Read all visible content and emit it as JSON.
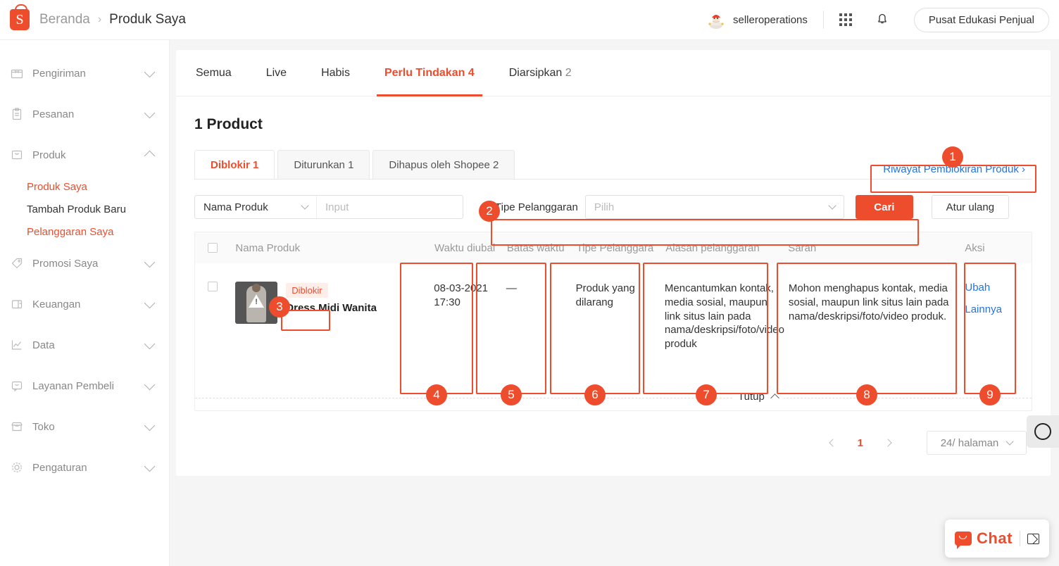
{
  "header": {
    "logo_icon": "shopee-bag-icon",
    "breadcrumb_home": "Beranda",
    "breadcrumb_sep": "›",
    "breadcrumb_current": "Produk Saya",
    "user_name": "selleroperations",
    "avatar_icon": "santa-avatar-icon",
    "apps_icon": "grid-apps-icon",
    "bell_icon": "notification-bell-icon",
    "edu_button": "Pusat Edukasi Penjual"
  },
  "sidebar": {
    "items": [
      {
        "label": "Pengiriman",
        "icon": "shipping-box-icon",
        "expanded": false
      },
      {
        "label": "Pesanan",
        "icon": "clipboard-icon",
        "expanded": false
      },
      {
        "label": "Produk",
        "icon": "product-box-icon",
        "expanded": true
      },
      {
        "label": "Promosi Saya",
        "icon": "tag-icon",
        "expanded": false
      },
      {
        "label": "Keuangan",
        "icon": "wallet-icon",
        "expanded": false
      },
      {
        "label": "Data",
        "icon": "chart-line-icon",
        "expanded": false
      },
      {
        "label": "Layanan Pembeli",
        "icon": "chat-bubble-icon",
        "expanded": false
      },
      {
        "label": "Toko",
        "icon": "store-icon",
        "expanded": false
      },
      {
        "label": "Pengaturan",
        "icon": "gear-icon",
        "expanded": false
      }
    ],
    "produk_subitems": [
      {
        "label": "Produk Saya",
        "selected": true
      },
      {
        "label": "Tambah Produk Baru",
        "selected": false
      },
      {
        "label": "Pelanggaran Saya",
        "selected": true
      }
    ]
  },
  "top_tabs": [
    {
      "label": "Semua",
      "count": "",
      "active": false
    },
    {
      "label": "Live",
      "count": "",
      "active": false
    },
    {
      "label": "Habis",
      "count": "",
      "active": false
    },
    {
      "label": "Perlu Tindakan",
      "count": "4",
      "active": true
    },
    {
      "label": "Diarsipkan",
      "count": "2",
      "active": false
    }
  ],
  "content": {
    "product_count_title": "1 Product",
    "sub_tabs": [
      {
        "label": "Diblokir",
        "count": "1",
        "active": true
      },
      {
        "label": "Diturunkan",
        "count": "1",
        "active": false
      },
      {
        "label": "Dihapus oleh Shopee",
        "count": "2",
        "active": false
      }
    ],
    "history_link": "Riwayat Pemblokiran Produk",
    "history_link_chevron": "›"
  },
  "filters": {
    "field_select_value": "Nama Produk",
    "keyword_placeholder": "Input",
    "keyword_value": "",
    "violation_label": "Tipe Pelanggaran",
    "violation_placeholder": "Pilih",
    "violation_value": "",
    "search_button": "Cari",
    "reset_button": "Atur ulang"
  },
  "table": {
    "columns": [
      "Nama Produk",
      "Waktu diubal",
      "Batas waktu",
      "Tipe Pelanggara",
      "Alasan pelanggaran",
      "Saran",
      "Aksi"
    ],
    "rows": [
      {
        "status_badge": "Diblokir",
        "product_name": "Dress Midi Wanita",
        "thumbnail_icon": "product-warning-thumbnail",
        "waktu_diubah": "08-03-2021 17:30",
        "batas_waktu": "—",
        "tipe_pelanggaran": "Produk yang dilarang",
        "alasan_pelanggaran": "Mencantumkan kontak, media sosial, maupun link situs lain pada nama/deskripsi/foto/video produk",
        "saran": "Mohon menghapus kontak, media sosial, maupun link situs lain pada nama/deskripsi/foto/video produk.",
        "actions": [
          "Ubah",
          "Lainnya"
        ]
      }
    ],
    "collapse_label": "Tutup"
  },
  "pagination": {
    "prev_icon": "chevron-left-icon",
    "next_icon": "chevron-right-icon",
    "current_page": "1",
    "per_page": "24/ halaman"
  },
  "widgets": {
    "float_button_icon": "circle-loader-icon",
    "chat_label": "Chat",
    "chat_icon": "chat-bubble-icon",
    "expand_icon": "expand-window-icon"
  },
  "annotations": [
    {
      "num": "1"
    },
    {
      "num": "2"
    },
    {
      "num": "3"
    },
    {
      "num": "4"
    },
    {
      "num": "5"
    },
    {
      "num": "6"
    },
    {
      "num": "7"
    },
    {
      "num": "8"
    },
    {
      "num": "9"
    }
  ],
  "colors": {
    "accent": "#ee4d2d",
    "link": "#2673dd",
    "text": "#333333",
    "muted": "#999999"
  }
}
